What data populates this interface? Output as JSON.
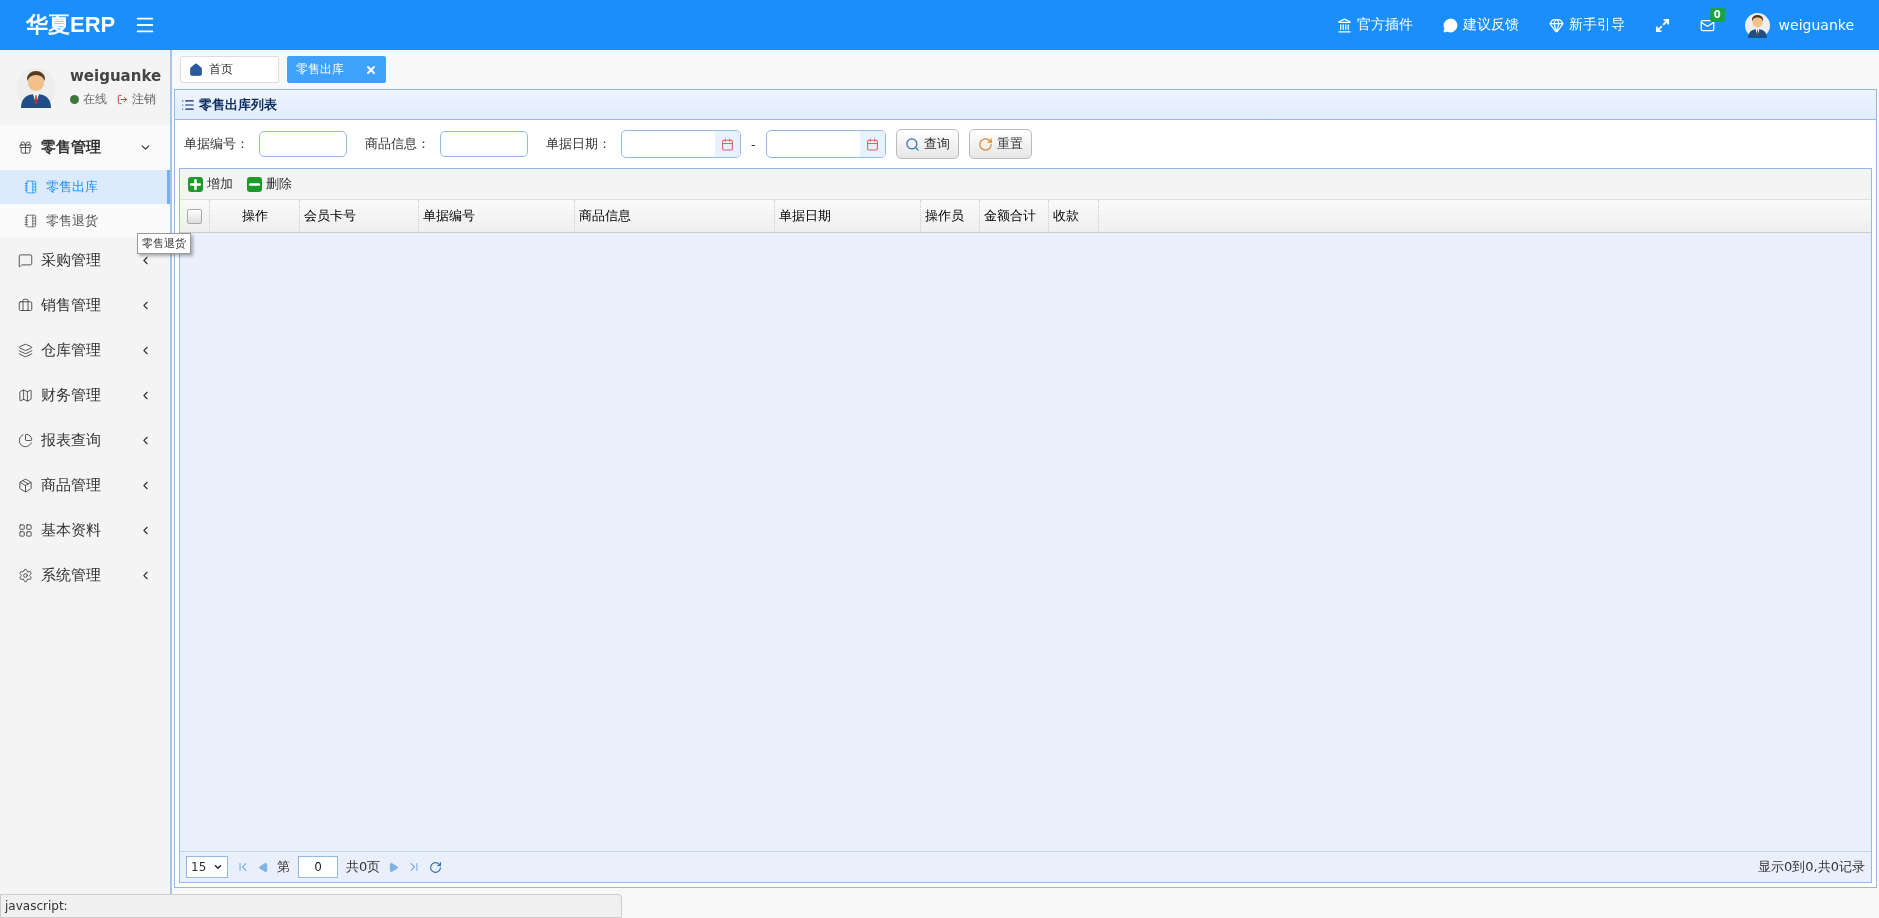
{
  "header": {
    "logo": "华夏ERP",
    "links": [
      {
        "label": "官方插件"
      },
      {
        "label": "建议反馈"
      },
      {
        "label": "新手引导"
      }
    ],
    "mail_badge": "0",
    "username": "weiguanke"
  },
  "sidebar": {
    "user": {
      "name": "weiguanke",
      "status": "在线",
      "logout": "注销"
    },
    "menu": [
      {
        "label": "零售管理",
        "expanded": true,
        "children": [
          {
            "label": "零售出库",
            "selected": true
          },
          {
            "label": "零售退货",
            "selected": false
          }
        ]
      },
      {
        "label": "采购管理",
        "expanded": false
      },
      {
        "label": "销售管理",
        "expanded": false
      },
      {
        "label": "仓库管理",
        "expanded": false
      },
      {
        "label": "财务管理",
        "expanded": false
      },
      {
        "label": "报表查询",
        "expanded": false
      },
      {
        "label": "商品管理",
        "expanded": false
      },
      {
        "label": "基本资料",
        "expanded": false
      },
      {
        "label": "系统管理",
        "expanded": false
      }
    ]
  },
  "tooltip": "零售退货",
  "tabs": [
    {
      "label": "首页",
      "selected": false,
      "closable": false
    },
    {
      "label": "零售出库",
      "selected": true,
      "closable": true
    }
  ],
  "panel": {
    "title": "零售出库列表",
    "filters": [
      {
        "kind": "text",
        "label": "单据编号："
      },
      {
        "kind": "text",
        "label": "商品信息："
      },
      {
        "kind": "date_range",
        "label": "单据日期：",
        "separator": "-"
      }
    ],
    "buttons": [
      {
        "kind": "search",
        "label": "查询"
      },
      {
        "kind": "reset",
        "label": "重置"
      }
    ],
    "toolbar": [
      {
        "kind": "add",
        "label": "增加"
      },
      {
        "kind": "delete",
        "label": "删除"
      }
    ],
    "table": {
      "select_all": false,
      "columns": [
        "操作",
        "会员卡号",
        "单据编号",
        "商品信息",
        "单据日期",
        "操作员",
        "金额合计",
        "收款"
      ]
    },
    "pager": {
      "page_size": "15",
      "page_prefix": "第",
      "page": "0",
      "page_suffix": "共0页",
      "summary": "显示0到0,共0记录"
    }
  },
  "status_bar": "javascript:"
}
